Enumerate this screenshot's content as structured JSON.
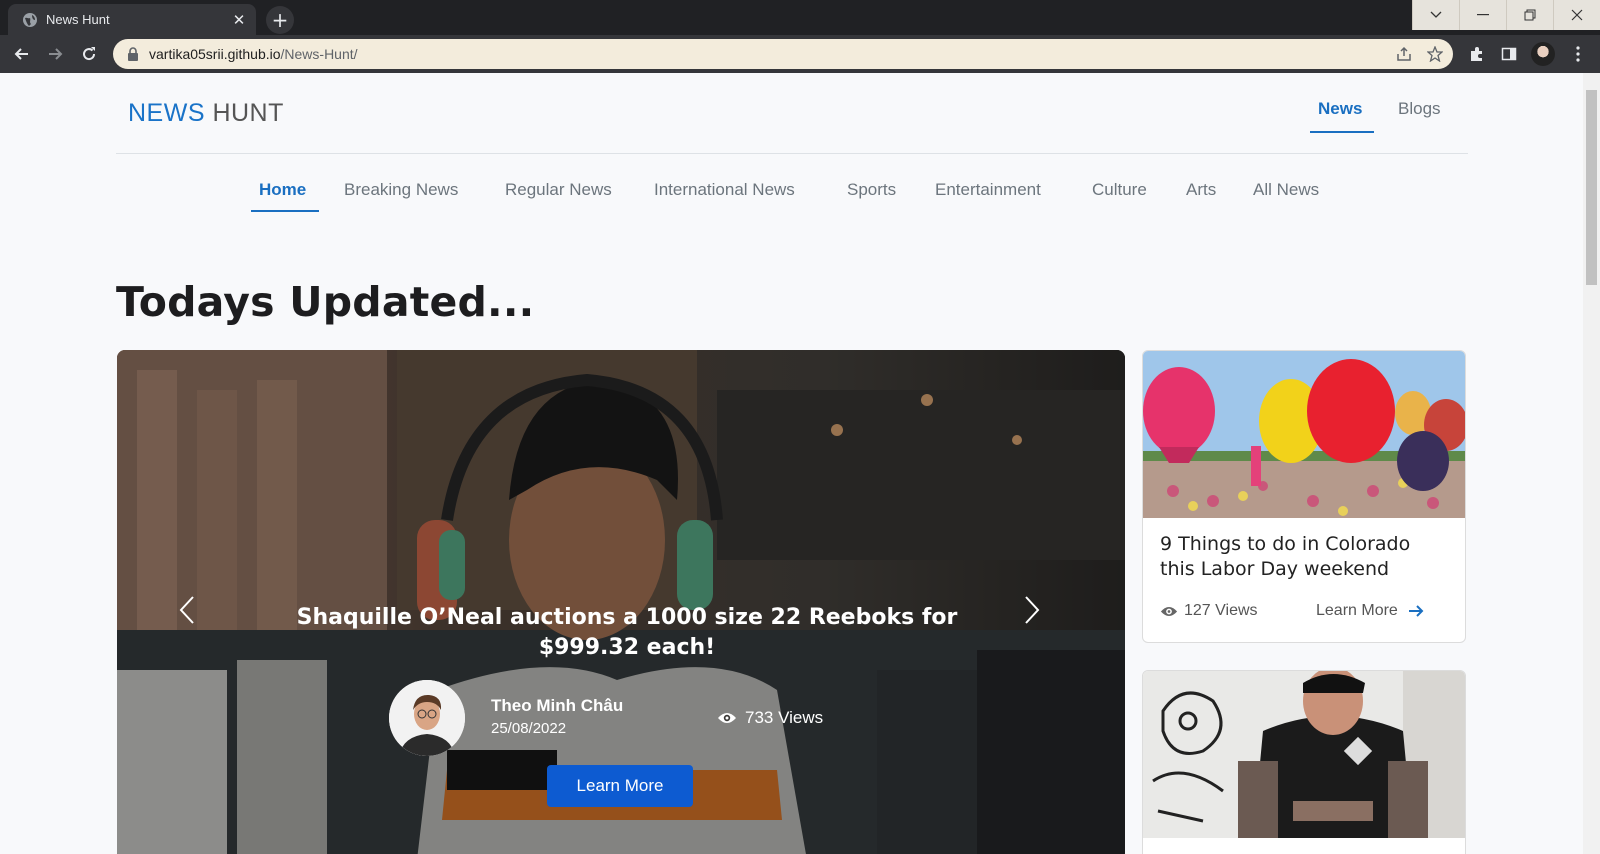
{
  "browser": {
    "tab_title": "News Hunt",
    "url_host": "vartika05srii.github.io",
    "url_path": "/News-Hunt/"
  },
  "site": {
    "brand_part1": "NEWS",
    "brand_part2": " HUNT",
    "top_nav": [
      {
        "label": "News",
        "active": true
      },
      {
        "label": "Blogs",
        "active": false
      }
    ],
    "categories": [
      {
        "label": "Home",
        "active": true
      },
      {
        "label": "Breaking News"
      },
      {
        "label": "Regular News"
      },
      {
        "label": "International News"
      },
      {
        "label": "Sports"
      },
      {
        "label": "Entertainment"
      },
      {
        "label": "Culture"
      },
      {
        "label": "Arts"
      },
      {
        "label": "All News"
      }
    ],
    "section_title": "Todays Updated..."
  },
  "slide": {
    "title": "Shaquille O’Neal auctions a 1000 size 22 Reeboks for $999.32 each!",
    "author": "Theo Minh Châu",
    "date": "25/08/2022",
    "views": "733 Views",
    "button": "Learn More",
    "slide_count": 3,
    "active_index": 0
  },
  "cards": [
    {
      "title": "9 Things to do in Colorado this Labor Day weekend",
      "views": "127 Views",
      "more": "Learn More"
    },
    {
      "title": ""
    }
  ],
  "colors": {
    "accent": "#1a6fc1",
    "button": "#0d5bd1"
  }
}
